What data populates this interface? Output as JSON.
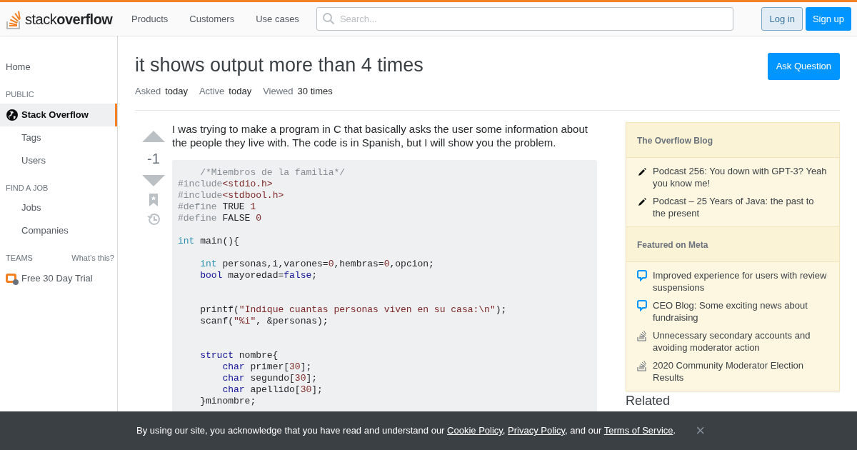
{
  "header": {
    "logo": "stack**overflow**",
    "nav": [
      "Products",
      "Customers",
      "Use cases"
    ],
    "search": {
      "placeholder": "Search..."
    },
    "buttons": [
      {
        "label": "Log in",
        "kind": "secondary"
      },
      {
        "label": "Sign up",
        "kind": "primary"
      }
    ]
  },
  "sidebar": {
    "items": [
      {
        "kind": "link",
        "label": "Home",
        "selected": false
      },
      {
        "kind": "heading",
        "label": "PUBLIC"
      },
      {
        "kind": "site",
        "label": "Stack Overflow",
        "selected": true
      },
      {
        "kind": "sublink",
        "label": "Tags",
        "selected": false
      },
      {
        "kind": "sublink",
        "label": "Users",
        "selected": false
      },
      {
        "kind": "heading",
        "label": "FIND A JOB"
      },
      {
        "kind": "sublink",
        "label": "Jobs",
        "selected": false
      },
      {
        "kind": "sublink",
        "label": "Companies",
        "selected": false
      },
      {
        "kind": "heading",
        "label": "TEAMS",
        "aside": "What’s this?"
      },
      {
        "kind": "teams",
        "label": "Free 30 Day Trial",
        "selected": false
      }
    ]
  },
  "question": {
    "title": "it shows output more than 4 times",
    "ask_button": "Ask Question",
    "meta": [
      {
        "label": "Asked",
        "value": "today"
      },
      {
        "label": "Active",
        "value": "today"
      },
      {
        "label": "Viewed",
        "value": "30 times"
      }
    ],
    "score": "-1",
    "body": "I was trying to make a program in C that basically asks the user some information about the people they live with. The code is in Spanish, but I will show you the problem.",
    "code": [
      {
        "tokens": [
          {
            "kind": "comment",
            "text": "    /*Miembros de la familia*/"
          }
        ]
      },
      {
        "tokens": [
          {
            "kind": "preproc",
            "text": "#include"
          },
          {
            "kind": "string",
            "text": "<stdio.h>"
          }
        ]
      },
      {
        "tokens": [
          {
            "kind": "preproc",
            "text": "#include"
          },
          {
            "kind": "string",
            "text": "<stdbool.h>"
          }
        ]
      },
      {
        "tokens": [
          {
            "kind": "preproc",
            "text": "#define"
          },
          {
            "kind": "plain",
            "text": " TRUE "
          },
          {
            "kind": "number",
            "text": "1"
          }
        ]
      },
      {
        "tokens": [
          {
            "kind": "preproc",
            "text": "#define"
          },
          {
            "kind": "plain",
            "text": " FALSE "
          },
          {
            "kind": "number",
            "text": "0"
          }
        ]
      },
      {
        "kind": "blank"
      },
      {
        "tokens": [
          {
            "kind": "type",
            "text": "int"
          },
          {
            "kind": "plain",
            "text": " main(){"
          }
        ]
      },
      {
        "kind": "blank"
      },
      {
        "tokens": [
          {
            "kind": "type",
            "text": "    int"
          },
          {
            "kind": "plain",
            "text": " personas,i,varones="
          },
          {
            "kind": "number",
            "text": "0"
          },
          {
            "kind": "plain",
            "text": ",hembras="
          },
          {
            "kind": "number",
            "text": "0"
          },
          {
            "kind": "plain",
            "text": ",opcion;"
          }
        ]
      },
      {
        "tokens": [
          {
            "kind": "keyword",
            "text": "    bool"
          },
          {
            "kind": "plain",
            "text": " mayoredad="
          },
          {
            "kind": "keyword",
            "text": "false"
          },
          {
            "kind": "plain",
            "text": ";"
          }
        ]
      },
      {
        "kind": "blank"
      },
      {
        "kind": "blank"
      },
      {
        "tokens": [
          {
            "kind": "plain",
            "text": "    printf("
          },
          {
            "kind": "string",
            "text": "\"Indique cuantas personas viven en su casa:\\n\""
          },
          {
            "kind": "plain",
            "text": ");"
          }
        ]
      },
      {
        "tokens": [
          {
            "kind": "plain",
            "text": "    scanf("
          },
          {
            "kind": "string",
            "text": "\"%i\""
          },
          {
            "kind": "plain",
            "text": ", &personas);"
          }
        ]
      },
      {
        "kind": "blank"
      },
      {
        "kind": "blank"
      },
      {
        "tokens": [
          {
            "kind": "keyword",
            "text": "    struct"
          },
          {
            "kind": "plain",
            "text": " nombre{"
          }
        ]
      },
      {
        "tokens": [
          {
            "kind": "keyword",
            "text": "        char"
          },
          {
            "kind": "plain",
            "text": " primer["
          },
          {
            "kind": "number",
            "text": "30"
          },
          {
            "kind": "plain",
            "text": "];"
          }
        ]
      },
      {
        "tokens": [
          {
            "kind": "keyword",
            "text": "        char"
          },
          {
            "kind": "plain",
            "text": " segundo["
          },
          {
            "kind": "number",
            "text": "30"
          },
          {
            "kind": "plain",
            "text": "];"
          }
        ]
      },
      {
        "tokens": [
          {
            "kind": "keyword",
            "text": "        char"
          },
          {
            "kind": "plain",
            "text": " apellido["
          },
          {
            "kind": "number",
            "text": "30"
          },
          {
            "kind": "plain",
            "text": "];"
          }
        ]
      },
      {
        "tokens": [
          {
            "kind": "plain",
            "text": "    }minombre;"
          }
        ]
      }
    ]
  },
  "widget": {
    "sections": [
      {
        "title": "The Overflow Blog",
        "items": [
          {
            "kind": "blog",
            "text": "Podcast 256: You down with GPT-3? Yeah you know me!"
          },
          {
            "kind": "blog",
            "text": "Podcast – 25 Years of Java: the past to the present"
          }
        ]
      },
      {
        "title": "Featured on Meta",
        "items": [
          {
            "kind": "meta",
            "text": "Improved experience for users with review suspensions"
          },
          {
            "kind": "meta",
            "text": "CEO Blog: Some exciting news about fundraising"
          },
          {
            "kind": "community",
            "text": "Unnecessary secondary accounts and avoiding moderator action"
          },
          {
            "kind": "community",
            "text": "2020 Community Moderator Election Results"
          }
        ]
      }
    ]
  },
  "related_heading": "Related",
  "cookie_banner": {
    "segments": [
      {
        "kind": "text",
        "text": "By using our site, you acknowledge that you have read and understand our "
      },
      {
        "kind": "link",
        "text": "Cookie Policy"
      },
      {
        "kind": "text",
        "text": ", "
      },
      {
        "kind": "link",
        "text": "Privacy Policy"
      },
      {
        "kind": "text",
        "text": ", and our "
      },
      {
        "kind": "link",
        "text": "Terms of Service"
      },
      {
        "kind": "text",
        "text": "."
      }
    ],
    "close": "×"
  }
}
